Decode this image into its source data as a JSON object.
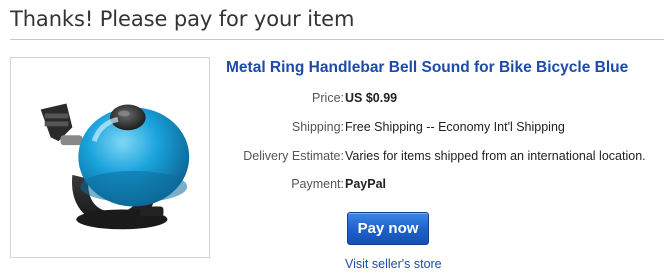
{
  "header": {
    "title": "Thanks! Please pay for your item"
  },
  "item": {
    "title": "Metal Ring Handlebar Bell Sound for Bike Bicycle Blue",
    "image_icon": "bike-bell-photo",
    "details": {
      "price_label": "Price:",
      "price_value": "US $0.99",
      "shipping_label": "Shipping:",
      "shipping_value": "Free Shipping -- Economy Int'l Shipping",
      "delivery_label": "Delivery Estimate:",
      "delivery_value": "Varies for items shipped from an international location.",
      "payment_label": "Payment:",
      "payment_value": "PayPal"
    }
  },
  "actions": {
    "pay_now_label": "Pay now",
    "seller_store_label": "Visit seller's store"
  },
  "colors": {
    "link_blue": "#1c4ba8",
    "button_blue": "#1f63cc",
    "bell_blue": "#1aa3dc"
  }
}
